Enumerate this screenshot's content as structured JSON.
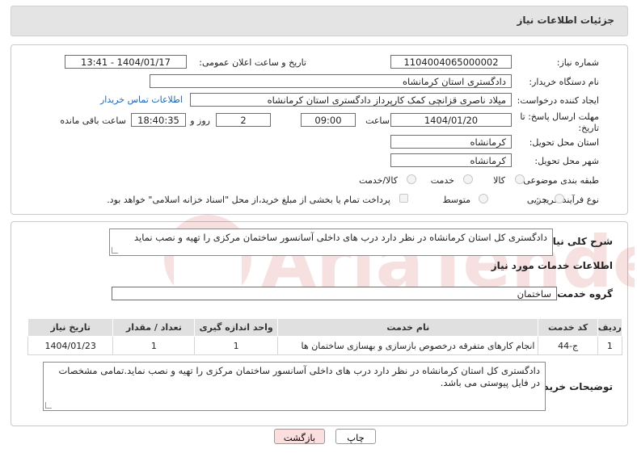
{
  "header": {
    "title": "جزئیات اطلاعات نیاز"
  },
  "form": {
    "need_number_label": "شماره نیاز:",
    "need_number": "1104004065000002",
    "announce_label": "تاریخ و ساعت اعلان عمومی:",
    "announce_value": "1404/01/17 - 13:41",
    "buyer_org_label": "نام دستگاه خریدار:",
    "buyer_org": "دادگستری استان کرمانشاه",
    "creator_label": "ایجاد کننده درخواست:",
    "creator": "میلاد ناصری قزانچی کمک کارپرداز دادگستری استان کرمانشاه",
    "contact_link": "اطلاعات تماس خریدار",
    "deadline_label_1": "مهلت ارسال پاسخ: تا",
    "deadline_label_2": "تاریخ:",
    "deadline_date": "1404/01/20",
    "time_label": "ساعت",
    "deadline_time": "09:00",
    "days_value": "2",
    "days_label": "روز و",
    "remaining_time": "18:40:35",
    "remaining_label": "ساعت باقی مانده",
    "province_label": "استان محل تحویل:",
    "province": "کرمانشاه",
    "city_label": "شهر محل تحویل:",
    "city": "کرمانشاه",
    "category_label": "طبقه بندی موضوعی:",
    "category_options": [
      "کالا",
      "خدمت",
      "کالا/خدمت"
    ],
    "process_label": "نوع فرآیند خرید :",
    "process_options": [
      "جزیی",
      "متوسط"
    ],
    "payment_note": "پرداخت تمام یا بخشی از مبلغ خرید،از محل \"اسناد خزانه اسلامی\" خواهد بود."
  },
  "summary": {
    "label": "شرح کلی نیاز:",
    "text": "دادگستری کل استان کرمانشاه در نظر دارد درب های داخلی آسانسور ساختمان مرکزی را تهیه و نصب نماید"
  },
  "services": {
    "section_title": "اطلاعات خدمات مورد نیاز",
    "group_label": "گروه خدمت:",
    "group_value": "ساختمان",
    "columns": [
      "ردیف",
      "کد خدمت",
      "نام خدمت",
      "واحد اندازه گیری",
      "تعداد / مقدار",
      "تاریخ نیاز"
    ],
    "rows": [
      {
        "row": "1",
        "code": "ج-44",
        "name": "انجام کارهای متفرقه درخصوص بازسازی و بهسازی ساختمان ها",
        "unit": "1",
        "qty": "1",
        "date": "1404/01/23"
      }
    ]
  },
  "buyer_notes": {
    "label": "توضیحات خریدار:",
    "text": "دادگستری کل استان کرمانشاه در نظر دارد درب های داخلی آسانسور ساختمان مرکزی را تهیه و نصب نماید.تمامی مشخصات در فایل پیوستی می باشد."
  },
  "buttons": {
    "print": "چاپ",
    "back": "بازگشت"
  },
  "watermark": {
    "text": "AriaTender.neT"
  },
  "colors": {
    "link": "#1a66c4",
    "header_bg": "#e4e4e4",
    "back_button_bg": "#fbdede",
    "watermark": "#c8342c"
  }
}
